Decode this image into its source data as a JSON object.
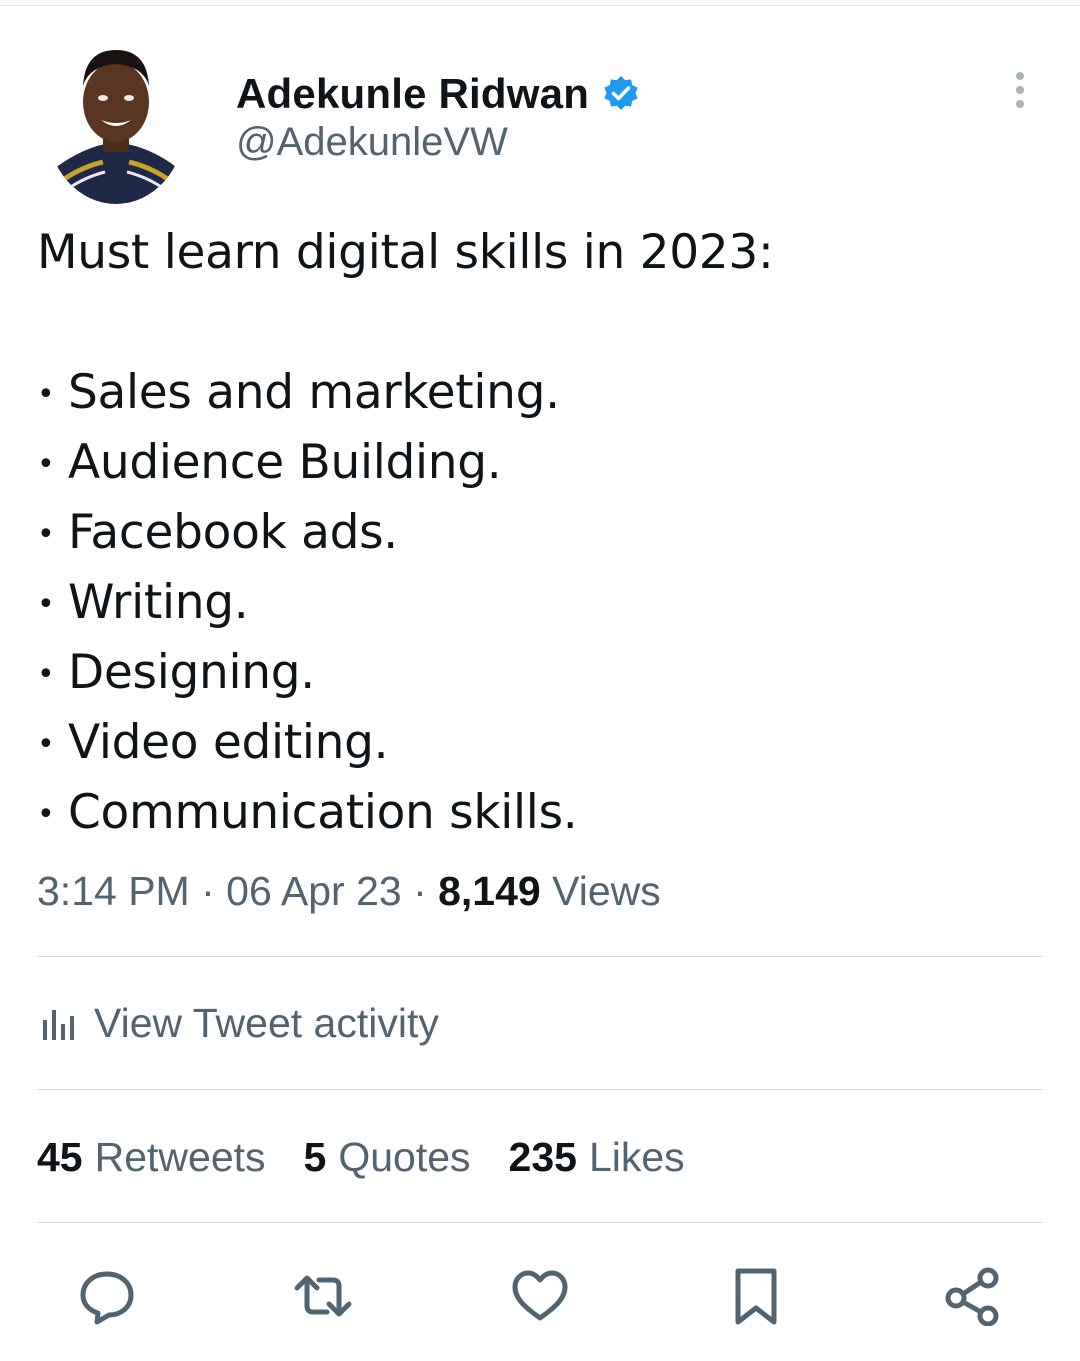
{
  "author": {
    "display_name": "Adekunle Ridwan",
    "handle": "@AdekunleVW",
    "verified": true
  },
  "tweet": {
    "intro": "Must learn digital skills in 2023:",
    "bullet_char": "•",
    "skills": [
      "Sales and marketing.",
      "Audience Building.",
      "Facebook ads.",
      "Writing.",
      "Designing.",
      "Video editing.",
      "Communication skills."
    ]
  },
  "meta": {
    "time": "3:14 PM",
    "separator": " · ",
    "date": "06 Apr 23",
    "views_count": "8,149",
    "views_label": "Views"
  },
  "activity": {
    "label": "View Tweet activity",
    "icon": "analytics-icon"
  },
  "stats": [
    {
      "count": "45",
      "label": "Retweets"
    },
    {
      "count": "5",
      "label": "Quotes"
    },
    {
      "count": "235",
      "label": "Likes"
    }
  ],
  "actions": [
    "reply-icon",
    "retweet-icon",
    "like-icon",
    "bookmark-icon",
    "share-icon"
  ],
  "colors": {
    "text_primary": "#0f1419",
    "text_secondary": "#536471",
    "verified_blue": "#1d9bf0",
    "divider": "#d7dbdf"
  }
}
